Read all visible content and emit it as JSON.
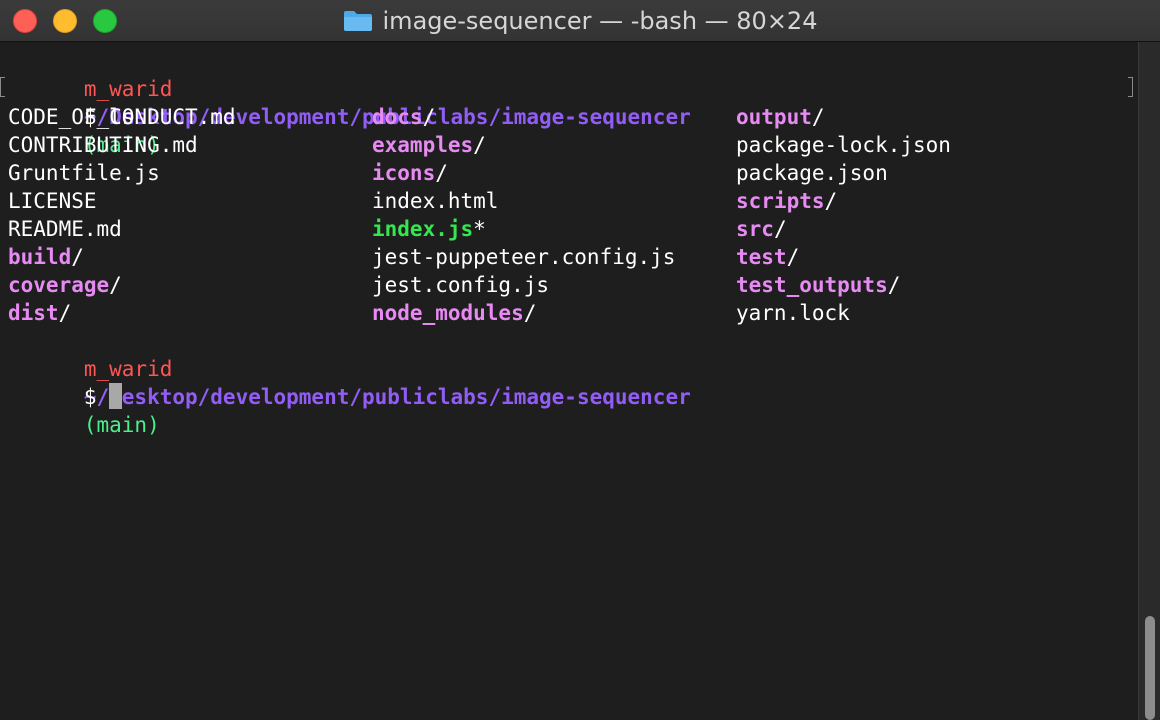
{
  "window": {
    "title": "image-sequencer — -bash — 80×24"
  },
  "icons": {
    "folder": "folder-icon"
  },
  "terminal": {
    "prompt1": {
      "user": "m_warid",
      "path": "~/Desktop/development/publiclabs/image-sequencer",
      "branch": "(main)"
    },
    "command1": "$ ls",
    "ls_columns": [
      [
        {
          "name": "CODE_OF_CONDUCT.md",
          "type": "file",
          "suffix": ""
        },
        {
          "name": "CONTRIBUTING.md",
          "type": "file",
          "suffix": ""
        },
        {
          "name": "Gruntfile.js",
          "type": "file",
          "suffix": ""
        },
        {
          "name": "LICENSE",
          "type": "file",
          "suffix": ""
        },
        {
          "name": "README.md",
          "type": "file",
          "suffix": ""
        },
        {
          "name": "build",
          "type": "dir",
          "suffix": "/"
        },
        {
          "name": "coverage",
          "type": "dir",
          "suffix": "/"
        },
        {
          "name": "dist",
          "type": "dir",
          "suffix": "/"
        }
      ],
      [
        {
          "name": "docs",
          "type": "dir",
          "suffix": "/"
        },
        {
          "name": "examples",
          "type": "dir",
          "suffix": "/"
        },
        {
          "name": "icons",
          "type": "dir",
          "suffix": "/"
        },
        {
          "name": "index.html",
          "type": "file",
          "suffix": ""
        },
        {
          "name": "index.js",
          "type": "exec",
          "suffix": "*"
        },
        {
          "name": "jest-puppeteer.config.js",
          "type": "file",
          "suffix": ""
        },
        {
          "name": "jest.config.js",
          "type": "file",
          "suffix": ""
        },
        {
          "name": "node_modules",
          "type": "dir",
          "suffix": "/"
        }
      ],
      [
        {
          "name": "output",
          "type": "dir",
          "suffix": "/"
        },
        {
          "name": "package-lock.json",
          "type": "file",
          "suffix": ""
        },
        {
          "name": "package.json",
          "type": "file",
          "suffix": ""
        },
        {
          "name": "scripts",
          "type": "dir",
          "suffix": "/"
        },
        {
          "name": "src",
          "type": "dir",
          "suffix": "/"
        },
        {
          "name": "test",
          "type": "dir",
          "suffix": "/"
        },
        {
          "name": "test_outputs",
          "type": "dir",
          "suffix": "/"
        },
        {
          "name": "yarn.lock",
          "type": "file",
          "suffix": ""
        }
      ]
    ],
    "prompt2": {
      "user": "m_warid",
      "path": "~/Desktop/development/publiclabs/image-sequencer",
      "branch": "(main)"
    },
    "command2": "$ "
  },
  "colors": {
    "user": "#ff5555",
    "path": "#915df5",
    "branch": "#4af08a",
    "directory": "#e78bf3",
    "executable": "#35e64f",
    "text": "#ffffff",
    "background": "#1e1e1e"
  }
}
